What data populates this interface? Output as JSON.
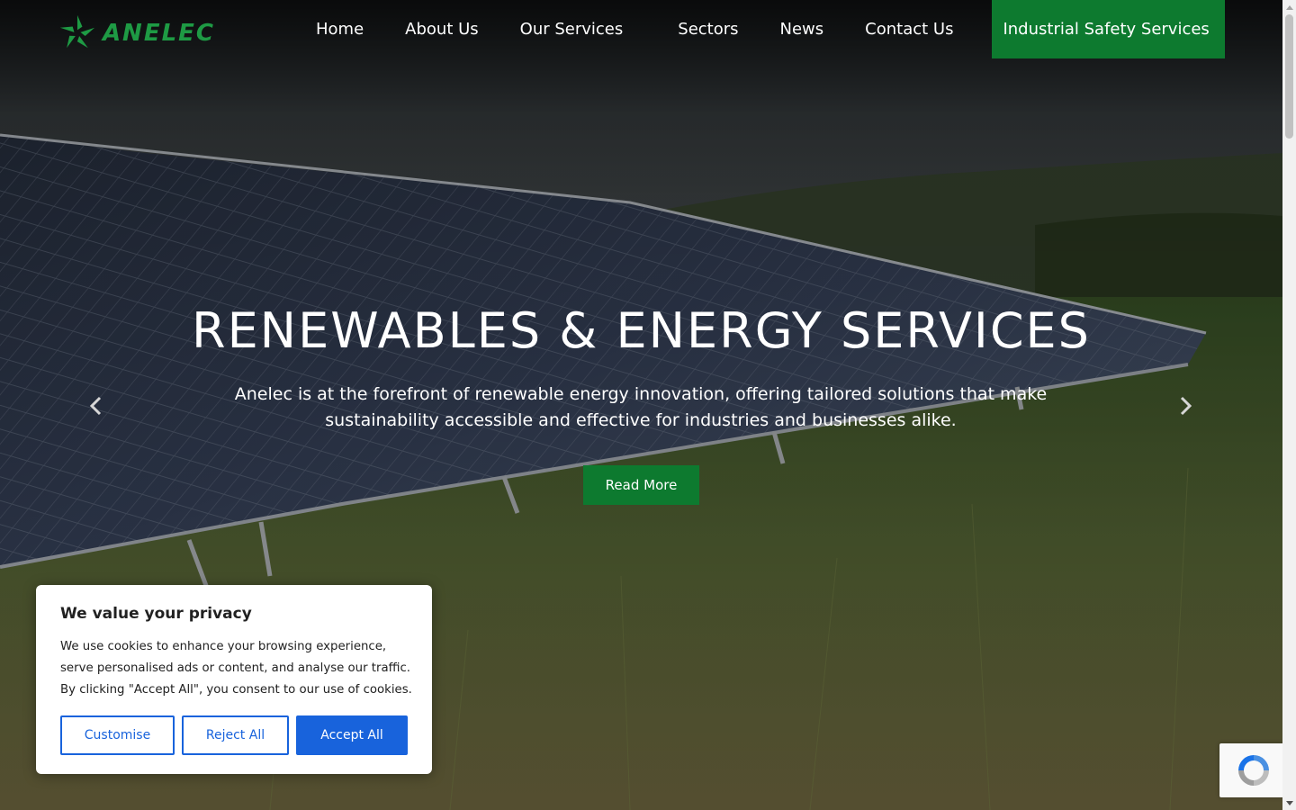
{
  "brand": {
    "name": "ANELEC",
    "accent": "#1e9a44",
    "cta_color": "#0d7a2f"
  },
  "nav": {
    "items": [
      "Home",
      "About Us",
      "Our Services",
      "Sectors",
      "News",
      "Contact Us"
    ],
    "cta": "Industrial Safety Services"
  },
  "hero": {
    "title": "RENEWABLES & ENERGY SERVICES",
    "text": "Anelec is at the forefront of renewable energy innovation, offering tailored solutions that make sustainability accessible and effective for industries and businesses alike.",
    "button": "Read More",
    "prev_icon": "chevron-left-icon",
    "next_icon": "chevron-right-icon"
  },
  "cookie": {
    "title": "We value your privacy",
    "text": "We use cookies to enhance your browsing experience, serve personalised ads or content, and analyse our traffic. By clicking \"Accept All\", you consent to our use of cookies.",
    "customise": "Customise",
    "reject": "Reject All",
    "accept": "Accept All",
    "button_color": "#1863dc"
  },
  "recaptcha": {
    "icon": "recaptcha-icon"
  }
}
